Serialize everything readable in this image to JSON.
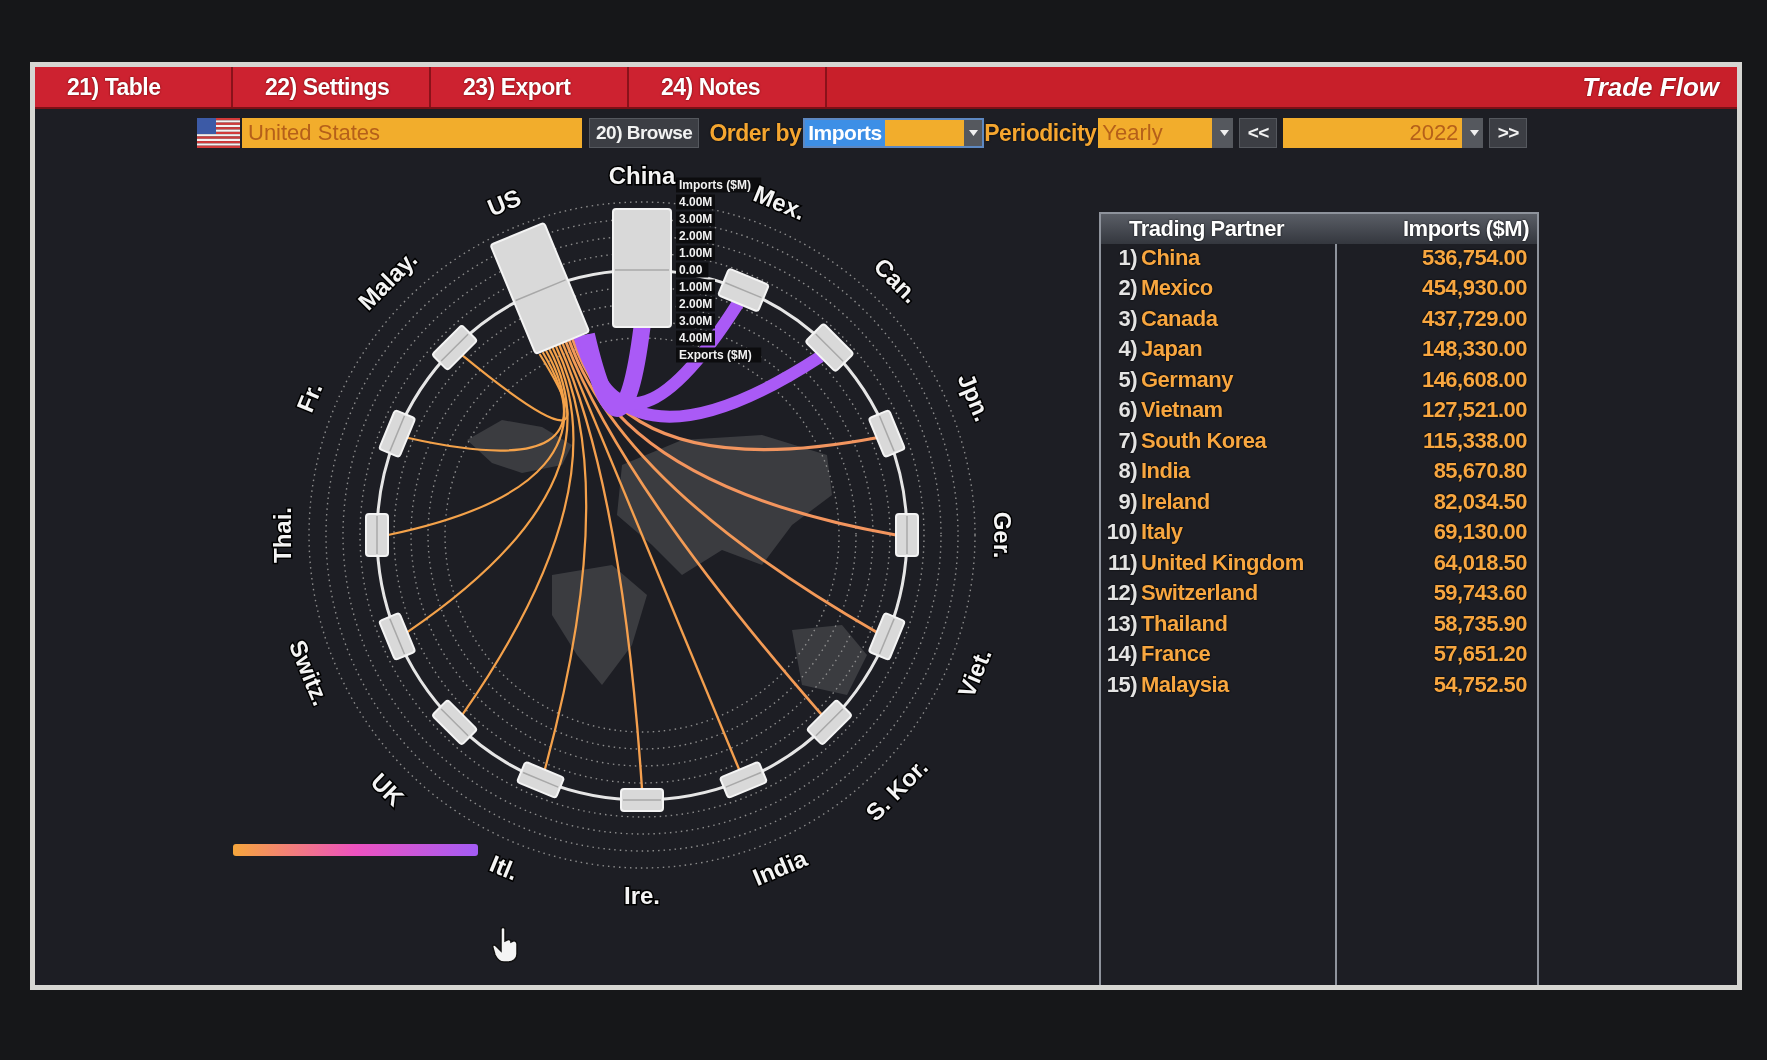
{
  "tabs": [
    {
      "label": "21) Table"
    },
    {
      "label": "22) Settings"
    },
    {
      "label": "23) Export"
    },
    {
      "label": "24) Notes"
    }
  ],
  "title": "Trade Flow",
  "controls": {
    "country": {
      "value": "United States"
    },
    "browse": {
      "label": "20) Browse"
    },
    "order_by": {
      "label": "Order by",
      "value": "Imports"
    },
    "periodicity": {
      "label": "Periodicity",
      "value": "Yearly"
    },
    "year": {
      "previous": "<<",
      "value": "2022",
      "next": ">>"
    }
  },
  "chart": {
    "nodes": [
      "US",
      "China",
      "Mex.",
      "Can.",
      "Jpn.",
      "Ger.",
      "Viet.",
      "S. Kor.",
      "India",
      "Ire.",
      "Itl.",
      "UK",
      "Switz.",
      "Thai.",
      "Fr.",
      "Malay."
    ],
    "scale": [
      "Imports ($M)",
      "4.00M",
      "3.00M",
      "2.00M",
      "1.00M",
      "0.00",
      "1.00M",
      "2.00M",
      "3.00M",
      "4.00M",
      "Exports ($M)"
    ]
  },
  "table": {
    "columns": [
      "Trading Partner",
      "Imports ($M)"
    ],
    "rows": [
      {
        "rank": "1)",
        "partner": "China",
        "imports": "536,754.00"
      },
      {
        "rank": "2)",
        "partner": "Mexico",
        "imports": "454,930.00"
      },
      {
        "rank": "3)",
        "partner": "Canada",
        "imports": "437,729.00"
      },
      {
        "rank": "4)",
        "partner": "Japan",
        "imports": "148,330.00"
      },
      {
        "rank": "5)",
        "partner": "Germany",
        "imports": "146,608.00"
      },
      {
        "rank": "6)",
        "partner": "Vietnam",
        "imports": "127,521.00"
      },
      {
        "rank": "7)",
        "partner": "South Korea",
        "imports": "115,338.00"
      },
      {
        "rank": "8)",
        "partner": "India",
        "imports": "85,670.80"
      },
      {
        "rank": "9)",
        "partner": "Ireland",
        "imports": "82,034.50"
      },
      {
        "rank": "10)",
        "partner": "Italy",
        "imports": "69,130.00"
      },
      {
        "rank": "11)",
        "partner": "United Kingdom",
        "imports": "64,018.50"
      },
      {
        "rank": "12)",
        "partner": "Switzerland",
        "imports": "59,743.60"
      },
      {
        "rank": "13)",
        "partner": "Thailand",
        "imports": "58,735.90"
      },
      {
        "rank": "14)",
        "partner": "France",
        "imports": "57,651.20"
      },
      {
        "rank": "15)",
        "partner": "Malaysia",
        "imports": "54,752.50"
      }
    ]
  }
}
